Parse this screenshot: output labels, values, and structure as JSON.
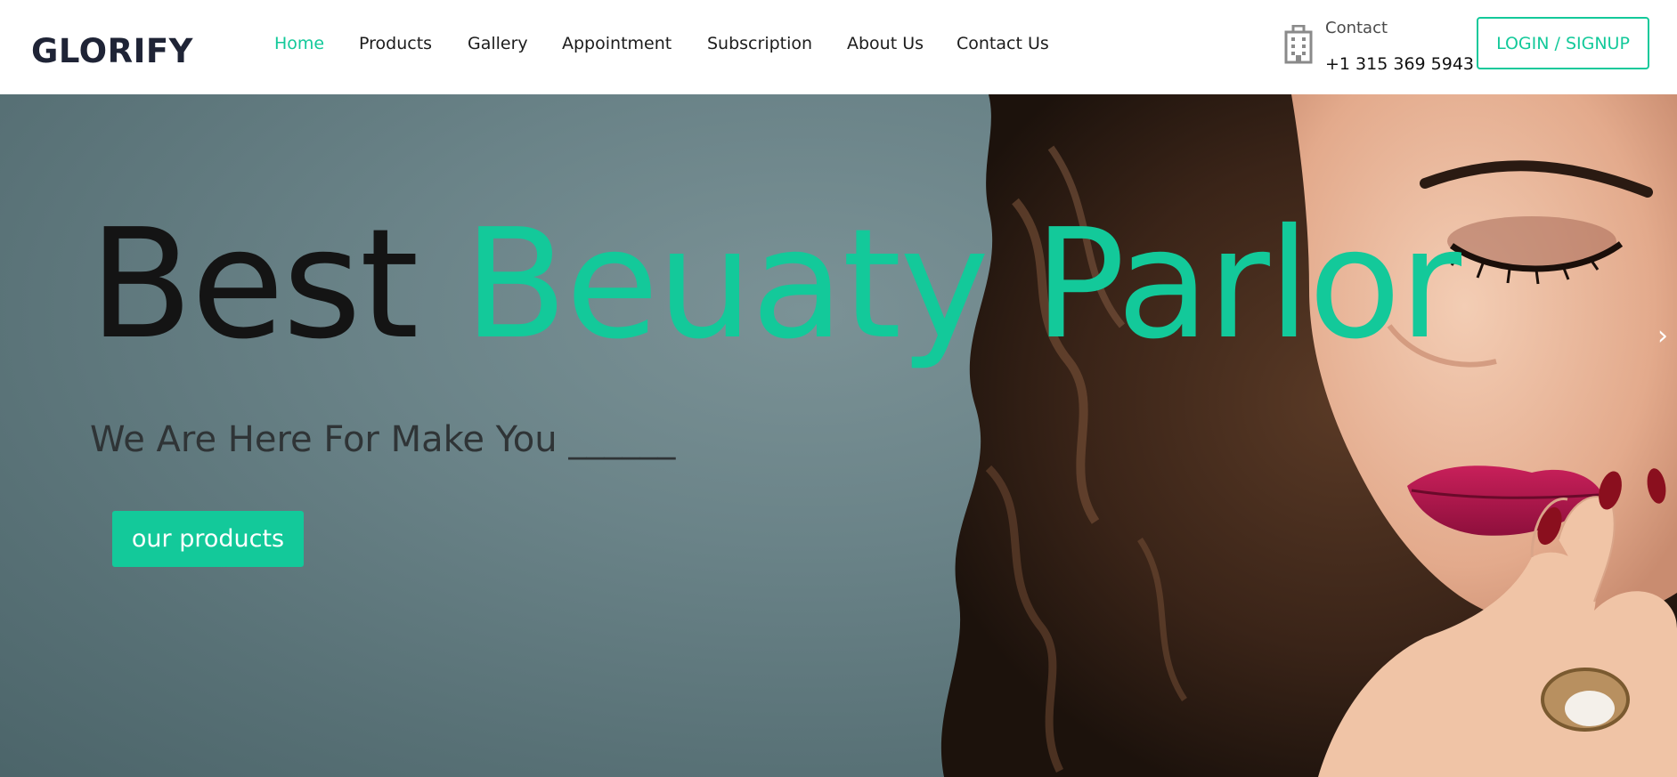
{
  "brand": {
    "logo_text": "GLORIFY"
  },
  "nav": {
    "items": [
      {
        "label": "Home",
        "active": true
      },
      {
        "label": "Products",
        "active": false
      },
      {
        "label": "Gallery",
        "active": false
      },
      {
        "label": "Appointment",
        "active": false
      },
      {
        "label": "Subscription",
        "active": false
      },
      {
        "label": "About Us",
        "active": false
      },
      {
        "label": "Contact Us",
        "active": false
      }
    ]
  },
  "contact": {
    "icon": "building-icon",
    "label": "Contact",
    "phone": "+1 315 369 5943"
  },
  "auth": {
    "login_label": "LOGIN / SIGNUP"
  },
  "hero": {
    "title_dark": "Best",
    "title_accent": "Beuaty Parlor",
    "subtitle": "We Are Here For Make You ______",
    "cta_label": "our products",
    "next_icon": "chevron-right-icon",
    "next_glyph": "›"
  },
  "colors": {
    "accent": "#13c99a",
    "logo": "#1f2436",
    "hero_background": "#6a8388"
  }
}
